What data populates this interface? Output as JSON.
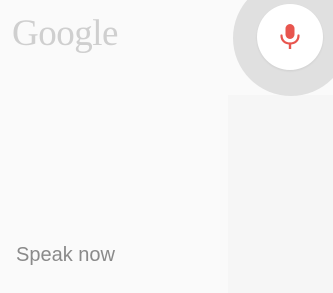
{
  "header": {
    "logo_text": "Google"
  },
  "voice": {
    "mic_icon": "microphone-icon",
    "mic_color": "#e8554e",
    "prompt_text": "Speak now"
  },
  "colors": {
    "background": "#fafafa",
    "ring": "#e0e0e0",
    "logo": "#cfcfcf",
    "prompt": "#8a8a8a"
  }
}
